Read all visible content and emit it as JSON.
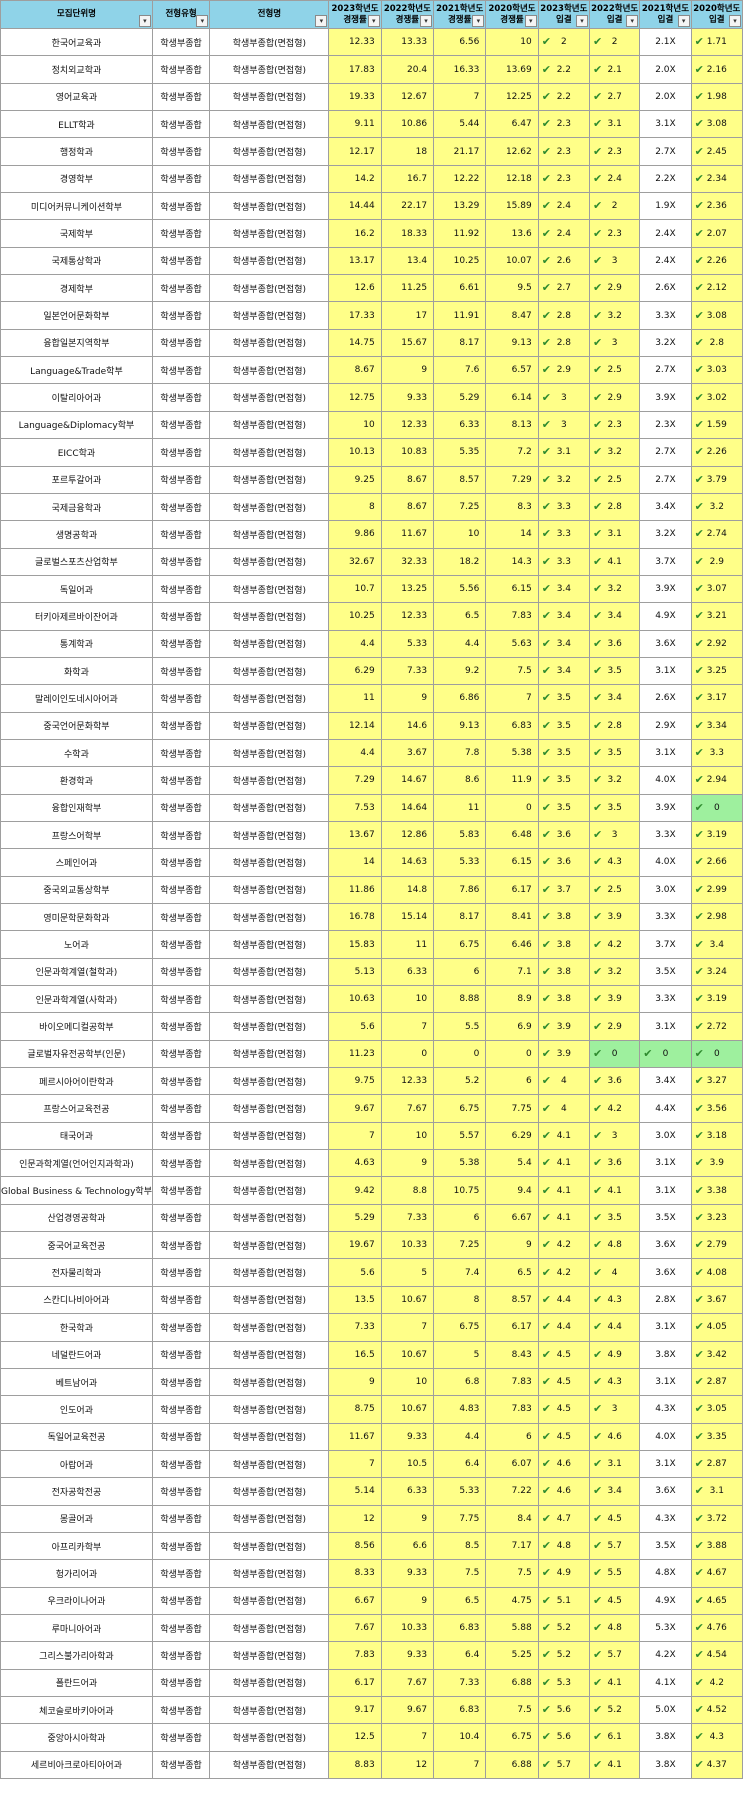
{
  "header": {
    "cols": [
      {
        "l1": "모집단위명",
        "l2": "",
        "filter": "▾"
      },
      {
        "l1": "전형유형",
        "l2": "",
        "filter": "▾"
      },
      {
        "l1": "전형명",
        "l2": "",
        "filter": "▾"
      },
      {
        "l1": "2023학년도",
        "l2": "경쟁률",
        "filter": "▾"
      },
      {
        "l1": "2022학년도",
        "l2": "경쟁률",
        "filter": "▾"
      },
      {
        "l1": "2021학년도",
        "l2": "경쟁률",
        "filter": "▾"
      },
      {
        "l1": "2020학년도",
        "l2": "경쟁률",
        "filter": "▾"
      },
      {
        "l1": "2023학년도",
        "l2": "입결",
        "filter": "▾"
      },
      {
        "l1": "2022학년도",
        "l2": "입결",
        "filter": "▾"
      },
      {
        "l1": "2021학년도",
        "l2": "입결",
        "filter": "▾"
      },
      {
        "l1": "2020학년도",
        "l2": "입결",
        "filter": "▾"
      }
    ]
  },
  "style": {
    "header_bg": "#8fd3e8",
    "yellow": "#ffff88",
    "green": "#9ef09e",
    "check": "#2e8b2e"
  },
  "icons": {
    "check": "✔",
    "filter": "filter-dropdown-icon"
  },
  "rows": [
    [
      "한국어교육과",
      "학생부종합",
      "학생부종합(면접형)",
      "12.33",
      "13.33",
      "6.56",
      "10",
      "2",
      "2",
      "2.1X",
      "1.71"
    ],
    [
      "정치외교학과",
      "학생부종합",
      "학생부종합(면접형)",
      "17.83",
      "20.4",
      "16.33",
      "13.69",
      "2.2",
      "2.1",
      "2.0X",
      "2.16"
    ],
    [
      "영어교육과",
      "학생부종합",
      "학생부종합(면접형)",
      "19.33",
      "12.67",
      "7",
      "12.25",
      "2.2",
      "2.7",
      "2.0X",
      "1.98"
    ],
    [
      "ELLT학과",
      "학생부종합",
      "학생부종합(면접형)",
      "9.11",
      "10.86",
      "5.44",
      "6.47",
      "2.3",
      "3.1",
      "3.1X",
      "3.08"
    ],
    [
      "행정학과",
      "학생부종합",
      "학생부종합(면접형)",
      "12.17",
      "18",
      "21.17",
      "12.62",
      "2.3",
      "2.3",
      "2.7X",
      "2.45"
    ],
    [
      "경영학부",
      "학생부종합",
      "학생부종합(면접형)",
      "14.2",
      "16.7",
      "12.22",
      "12.18",
      "2.3",
      "2.4",
      "2.2X",
      "2.34"
    ],
    [
      "미디어커뮤니케이션학부",
      "학생부종합",
      "학생부종합(면접형)",
      "14.44",
      "22.17",
      "13.29",
      "15.89",
      "2.4",
      "2",
      "1.9X",
      "2.36"
    ],
    [
      "국제학부",
      "학생부종합",
      "학생부종합(면접형)",
      "16.2",
      "18.33",
      "11.92",
      "13.6",
      "2.4",
      "2.3",
      "2.4X",
      "2.07"
    ],
    [
      "국제통상학과",
      "학생부종합",
      "학생부종합(면접형)",
      "13.17",
      "13.4",
      "10.25",
      "10.07",
      "2.6",
      "3",
      "2.4X",
      "2.26"
    ],
    [
      "경제학부",
      "학생부종합",
      "학생부종합(면접형)",
      "12.6",
      "11.25",
      "6.61",
      "9.5",
      "2.7",
      "2.9",
      "2.6X",
      "2.12"
    ],
    [
      "일본언어문화학부",
      "학생부종합",
      "학생부종합(면접형)",
      "17.33",
      "17",
      "11.91",
      "8.47",
      "2.8",
      "3.2",
      "3.3X",
      "3.08"
    ],
    [
      "융합일본지역학부",
      "학생부종합",
      "학생부종합(면접형)",
      "14.75",
      "15.67",
      "8.17",
      "9.13",
      "2.8",
      "3",
      "3.2X",
      "2.8"
    ],
    [
      "Language&Trade학부",
      "학생부종합",
      "학생부종합(면접형)",
      "8.67",
      "9",
      "7.6",
      "6.57",
      "2.9",
      "2.5",
      "2.7X",
      "3.03"
    ],
    [
      "이탈리아어과",
      "학생부종합",
      "학생부종합(면접형)",
      "12.75",
      "9.33",
      "5.29",
      "6.14",
      "3",
      "2.9",
      "3.9X",
      "3.02"
    ],
    [
      "Language&Diplomacy학부",
      "학생부종합",
      "학생부종합(면접형)",
      "10",
      "12.33",
      "6.33",
      "8.13",
      "3",
      "2.3",
      "2.3X",
      "1.59"
    ],
    [
      "EICC학과",
      "학생부종합",
      "학생부종합(면접형)",
      "10.13",
      "10.83",
      "5.35",
      "7.2",
      "3.1",
      "3.2",
      "2.7X",
      "2.26"
    ],
    [
      "포르투갈어과",
      "학생부종합",
      "학생부종합(면접형)",
      "9.25",
      "8.67",
      "8.57",
      "7.29",
      "3.2",
      "2.5",
      "2.7X",
      "3.79"
    ],
    [
      "국제금융학과",
      "학생부종합",
      "학생부종합(면접형)",
      "8",
      "8.67",
      "7.25",
      "8.3",
      "3.3",
      "2.8",
      "3.4X",
      "3.2"
    ],
    [
      "생명공학과",
      "학생부종합",
      "학생부종합(면접형)",
      "9.86",
      "11.67",
      "10",
      "14",
      "3.3",
      "3.1",
      "3.2X",
      "2.74"
    ],
    [
      "글로벌스포츠산업학부",
      "학생부종합",
      "학생부종합(면접형)",
      "32.67",
      "32.33",
      "18.2",
      "14.3",
      "3.3",
      "4.1",
      "3.7X",
      "2.9"
    ],
    [
      "독일어과",
      "학생부종합",
      "학생부종합(면접형)",
      "10.7",
      "13.25",
      "5.56",
      "6.15",
      "3.4",
      "3.2",
      "3.9X",
      "3.07"
    ],
    [
      "터키아제르바이잔어과",
      "학생부종합",
      "학생부종합(면접형)",
      "10.25",
      "12.33",
      "6.5",
      "7.83",
      "3.4",
      "3.4",
      "4.9X",
      "3.21"
    ],
    [
      "통계학과",
      "학생부종합",
      "학생부종합(면접형)",
      "4.4",
      "5.33",
      "4.4",
      "5.63",
      "3.4",
      "3.6",
      "3.6X",
      "2.92"
    ],
    [
      "화학과",
      "학생부종합",
      "학생부종합(면접형)",
      "6.29",
      "7.33",
      "9.2",
      "7.5",
      "3.4",
      "3.5",
      "3.1X",
      "3.25"
    ],
    [
      "말레이인도네시아어과",
      "학생부종합",
      "학생부종합(면접형)",
      "11",
      "9",
      "6.86",
      "7",
      "3.5",
      "3.4",
      "2.6X",
      "3.17"
    ],
    [
      "중국언어문화학부",
      "학생부종합",
      "학생부종합(면접형)",
      "12.14",
      "14.6",
      "9.13",
      "6.83",
      "3.5",
      "2.8",
      "2.9X",
      "3.34"
    ],
    [
      "수학과",
      "학생부종합",
      "학생부종합(면접형)",
      "4.4",
      "3.67",
      "7.8",
      "5.38",
      "3.5",
      "3.5",
      "3.1X",
      "3.3"
    ],
    [
      "환경학과",
      "학생부종합",
      "학생부종합(면접형)",
      "7.29",
      "14.67",
      "8.6",
      "11.9",
      "3.5",
      "3.2",
      "4.0X",
      "2.94"
    ],
    [
      "융합인재학부",
      "학생부종합",
      "학생부종합(면접형)",
      "7.53",
      "14.64",
      "11",
      "0",
      "3.5",
      "3.5",
      "3.9X",
      "0"
    ],
    [
      "프랑스어학부",
      "학생부종합",
      "학생부종합(면접형)",
      "13.67",
      "12.86",
      "5.83",
      "6.48",
      "3.6",
      "3",
      "3.3X",
      "3.19"
    ],
    [
      "스페인어과",
      "학생부종합",
      "학생부종합(면접형)",
      "14",
      "14.63",
      "5.33",
      "6.15",
      "3.6",
      "4.3",
      "4.0X",
      "2.66"
    ],
    [
      "중국외교통상학부",
      "학생부종합",
      "학생부종합(면접형)",
      "11.86",
      "14.8",
      "7.86",
      "6.17",
      "3.7",
      "2.5",
      "3.0X",
      "2.99"
    ],
    [
      "영미문학문화학과",
      "학생부종합",
      "학생부종합(면접형)",
      "16.78",
      "15.14",
      "8.17",
      "8.41",
      "3.8",
      "3.9",
      "3.3X",
      "2.98"
    ],
    [
      "노어과",
      "학생부종합",
      "학생부종합(면접형)",
      "15.83",
      "11",
      "6.75",
      "6.46",
      "3.8",
      "4.2",
      "3.7X",
      "3.4"
    ],
    [
      "인문과학계열(철학과)",
      "학생부종합",
      "학생부종합(면접형)",
      "5.13",
      "6.33",
      "6",
      "7.1",
      "3.8",
      "3.2",
      "3.5X",
      "3.24"
    ],
    [
      "인문과학계열(사학과)",
      "학생부종합",
      "학생부종합(면접형)",
      "10.63",
      "10",
      "8.88",
      "8.9",
      "3.8",
      "3.9",
      "3.3X",
      "3.19"
    ],
    [
      "바이오메디컬공학부",
      "학생부종합",
      "학생부종합(면접형)",
      "5.6",
      "7",
      "5.5",
      "6.9",
      "3.9",
      "2.9",
      "3.1X",
      "2.72"
    ],
    [
      "글로벌자유전공학부(인문)",
      "학생부종합",
      "학생부종합(면접형)",
      "11.23",
      "0",
      "0",
      "0",
      "3.9",
      "0",
      "0",
      "0"
    ],
    [
      "페르시아어이란학과",
      "학생부종합",
      "학생부종합(면접형)",
      "9.75",
      "12.33",
      "5.2",
      "6",
      "4",
      "3.6",
      "3.4X",
      "3.27"
    ],
    [
      "프랑스어교육전공",
      "학생부종합",
      "학생부종합(면접형)",
      "9.67",
      "7.67",
      "6.75",
      "7.75",
      "4",
      "4.2",
      "4.4X",
      "3.56"
    ],
    [
      "태국어과",
      "학생부종합",
      "학생부종합(면접형)",
      "7",
      "10",
      "5.57",
      "6.29",
      "4.1",
      "3",
      "3.0X",
      "3.18"
    ],
    [
      "인문과학계열(언어인지과학과)",
      "학생부종합",
      "학생부종합(면접형)",
      "4.63",
      "9",
      "5.38",
      "5.4",
      "4.1",
      "3.6",
      "3.1X",
      "3.9"
    ],
    [
      "Global Business & Technology학부",
      "학생부종합",
      "학생부종합(면접형)",
      "9.42",
      "8.8",
      "10.75",
      "9.4",
      "4.1",
      "4.1",
      "3.1X",
      "3.38"
    ],
    [
      "산업경영공학과",
      "학생부종합",
      "학생부종합(면접형)",
      "5.29",
      "7.33",
      "6",
      "6.67",
      "4.1",
      "3.5",
      "3.5X",
      "3.23"
    ],
    [
      "중국어교육전공",
      "학생부종합",
      "학생부종합(면접형)",
      "19.67",
      "10.33",
      "7.25",
      "9",
      "4.2",
      "4.8",
      "3.6X",
      "2.79"
    ],
    [
      "전자물리학과",
      "학생부종합",
      "학생부종합(면접형)",
      "5.6",
      "5",
      "7.4",
      "6.5",
      "4.2",
      "4",
      "3.6X",
      "4.08"
    ],
    [
      "스칸디나비아어과",
      "학생부종합",
      "학생부종합(면접형)",
      "13.5",
      "10.67",
      "8",
      "8.57",
      "4.4",
      "4.3",
      "2.8X",
      "3.67"
    ],
    [
      "한국학과",
      "학생부종합",
      "학생부종합(면접형)",
      "7.33",
      "7",
      "6.75",
      "6.17",
      "4.4",
      "4.4",
      "3.1X",
      "4.05"
    ],
    [
      "네덜란드어과",
      "학생부종합",
      "학생부종합(면접형)",
      "16.5",
      "10.67",
      "5",
      "8.43",
      "4.5",
      "4.9",
      "3.8X",
      "3.42"
    ],
    [
      "베트남어과",
      "학생부종합",
      "학생부종합(면접형)",
      "9",
      "10",
      "6.8",
      "7.83",
      "4.5",
      "4.3",
      "3.1X",
      "2.87"
    ],
    [
      "인도어과",
      "학생부종합",
      "학생부종합(면접형)",
      "8.75",
      "10.67",
      "4.83",
      "7.83",
      "4.5",
      "3",
      "4.3X",
      "3.05"
    ],
    [
      "독일어교육전공",
      "학생부종합",
      "학생부종합(면접형)",
      "11.67",
      "9.33",
      "4.4",
      "6",
      "4.5",
      "4.6",
      "4.0X",
      "3.35"
    ],
    [
      "아랍어과",
      "학생부종합",
      "학생부종합(면접형)",
      "7",
      "10.5",
      "6.4",
      "6.07",
      "4.6",
      "3.1",
      "3.1X",
      "2.87"
    ],
    [
      "전자공학전공",
      "학생부종합",
      "학생부종합(면접형)",
      "5.14",
      "6.33",
      "5.33",
      "7.22",
      "4.6",
      "3.4",
      "3.6X",
      "3.1"
    ],
    [
      "몽골어과",
      "학생부종합",
      "학생부종합(면접형)",
      "12",
      "9",
      "7.75",
      "8.4",
      "4.7",
      "4.5",
      "4.3X",
      "3.72"
    ],
    [
      "아프리카학부",
      "학생부종합",
      "학생부종합(면접형)",
      "8.56",
      "6.6",
      "8.5",
      "7.17",
      "4.8",
      "5.7",
      "3.5X",
      "3.88"
    ],
    [
      "헝가리어과",
      "학생부종합",
      "학생부종합(면접형)",
      "8.33",
      "9.33",
      "7.5",
      "7.5",
      "4.9",
      "5.5",
      "4.8X",
      "4.67"
    ],
    [
      "우크라이나어과",
      "학생부종합",
      "학생부종합(면접형)",
      "6.67",
      "9",
      "6.5",
      "4.75",
      "5.1",
      "4.5",
      "4.9X",
      "4.65"
    ],
    [
      "루마니아어과",
      "학생부종합",
      "학생부종합(면접형)",
      "7.67",
      "10.33",
      "6.83",
      "5.88",
      "5.2",
      "4.8",
      "5.3X",
      "4.76"
    ],
    [
      "그리스불가리아학과",
      "학생부종합",
      "학생부종합(면접형)",
      "7.83",
      "9.33",
      "6.4",
      "5.25",
      "5.2",
      "5.7",
      "4.2X",
      "4.54"
    ],
    [
      "폴란드어과",
      "학생부종합",
      "학생부종합(면접형)",
      "6.17",
      "7.67",
      "7.33",
      "6.88",
      "5.3",
      "4.1",
      "4.1X",
      "4.2"
    ],
    [
      "체코슬로바키아어과",
      "학생부종합",
      "학생부종합(면접형)",
      "9.17",
      "9.67",
      "6.83",
      "7.5",
      "5.6",
      "5.2",
      "5.0X",
      "4.52"
    ],
    [
      "중앙아시아학과",
      "학생부종합",
      "학생부종합(면접형)",
      "12.5",
      "7",
      "10.4",
      "6.75",
      "5.6",
      "6.1",
      "3.8X",
      "4.3"
    ],
    [
      "세르비아크로아티아어과",
      "학생부종합",
      "학생부종합(면접형)",
      "8.83",
      "12",
      "7",
      "6.88",
      "5.7",
      "4.1",
      "3.8X",
      "4.37"
    ]
  ]
}
